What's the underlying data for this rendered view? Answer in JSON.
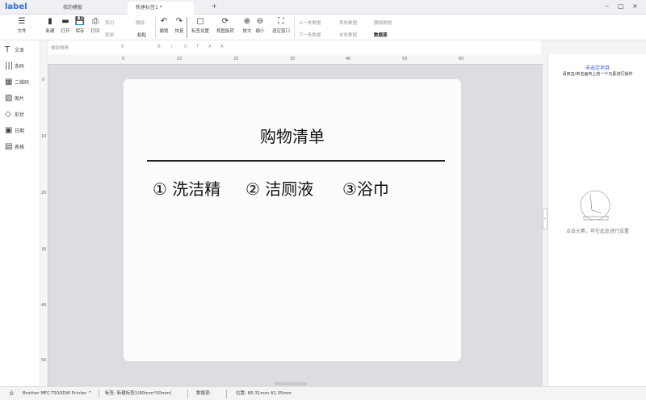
{
  "app": {
    "logo": "label"
  },
  "tabs": [
    {
      "label": "我的模板"
    },
    {
      "label": "新建标签1 *"
    }
  ],
  "window": {
    "minimize": "–",
    "maximize": "▢",
    "close": "×",
    "new_tab": "+"
  },
  "toolbar": {
    "menu": "文件",
    "buttons": [
      {
        "label": "新建",
        "icon": "▮"
      },
      {
        "label": "打开",
        "icon": "▬"
      },
      {
        "label": "保存",
        "icon": "💾"
      },
      {
        "label": "打印",
        "icon": "⎙"
      },
      {
        "label": "撤销",
        "icon": "↶"
      },
      {
        "label": "恢复",
        "icon": "↷"
      },
      {
        "label": "标签设置",
        "icon": "▢"
      },
      {
        "label": "视图旋转",
        "icon": "⟳"
      },
      {
        "label": "放大",
        "icon": "⊕"
      },
      {
        "label": "缩小",
        "icon": "⊖"
      },
      {
        "label": "适应窗口",
        "icon": "⛶"
      }
    ],
    "small": {
      "cut": "剪切",
      "copy": "复制",
      "delete": "删除",
      "paste": "粘贴",
      "prev": "上一条数据",
      "next": "下一条数据",
      "first": "首条数据",
      "last": "末条数据",
      "del_data": "删除数据",
      "datasource": "数据源"
    }
  },
  "formatbar": {
    "font": "微软雅黑",
    "size": "9",
    "styles": [
      "B",
      "I",
      "U",
      "T",
      "A",
      "A"
    ]
  },
  "sidebar": [
    {
      "label": "文本",
      "icon": "T"
    },
    {
      "label": "条码",
      "icon": "|||"
    },
    {
      "label": "二维码",
      "icon": "▦"
    },
    {
      "label": "图片",
      "icon": "▨"
    },
    {
      "label": "形状",
      "icon": "◇"
    },
    {
      "label": "日期",
      "icon": "▣"
    },
    {
      "label": "表格",
      "icon": "▤"
    }
  ],
  "ruler": {
    "top": [
      "0",
      "10",
      "20",
      "30",
      "40",
      "50",
      "60"
    ],
    "left": [
      "0",
      "10",
      "20",
      "30",
      "40",
      "50"
    ]
  },
  "label": {
    "title": "购物清单",
    "items": [
      "① 洗洁精",
      "② 洁厕液",
      "③浴巾"
    ]
  },
  "right_panel": {
    "title": "未选定项目",
    "hint": "请双击/单击画布上的一个元素进行操作",
    "empty": "点击元素，可在此处进行设置"
  },
  "status": {
    "printer": "Brother MFC-T910DW Printer ^",
    "label": "标签: 新建标签1(60mm*50mm)",
    "datasource": "数据源:",
    "position": "位置: 66.31mm 41.35mm"
  }
}
